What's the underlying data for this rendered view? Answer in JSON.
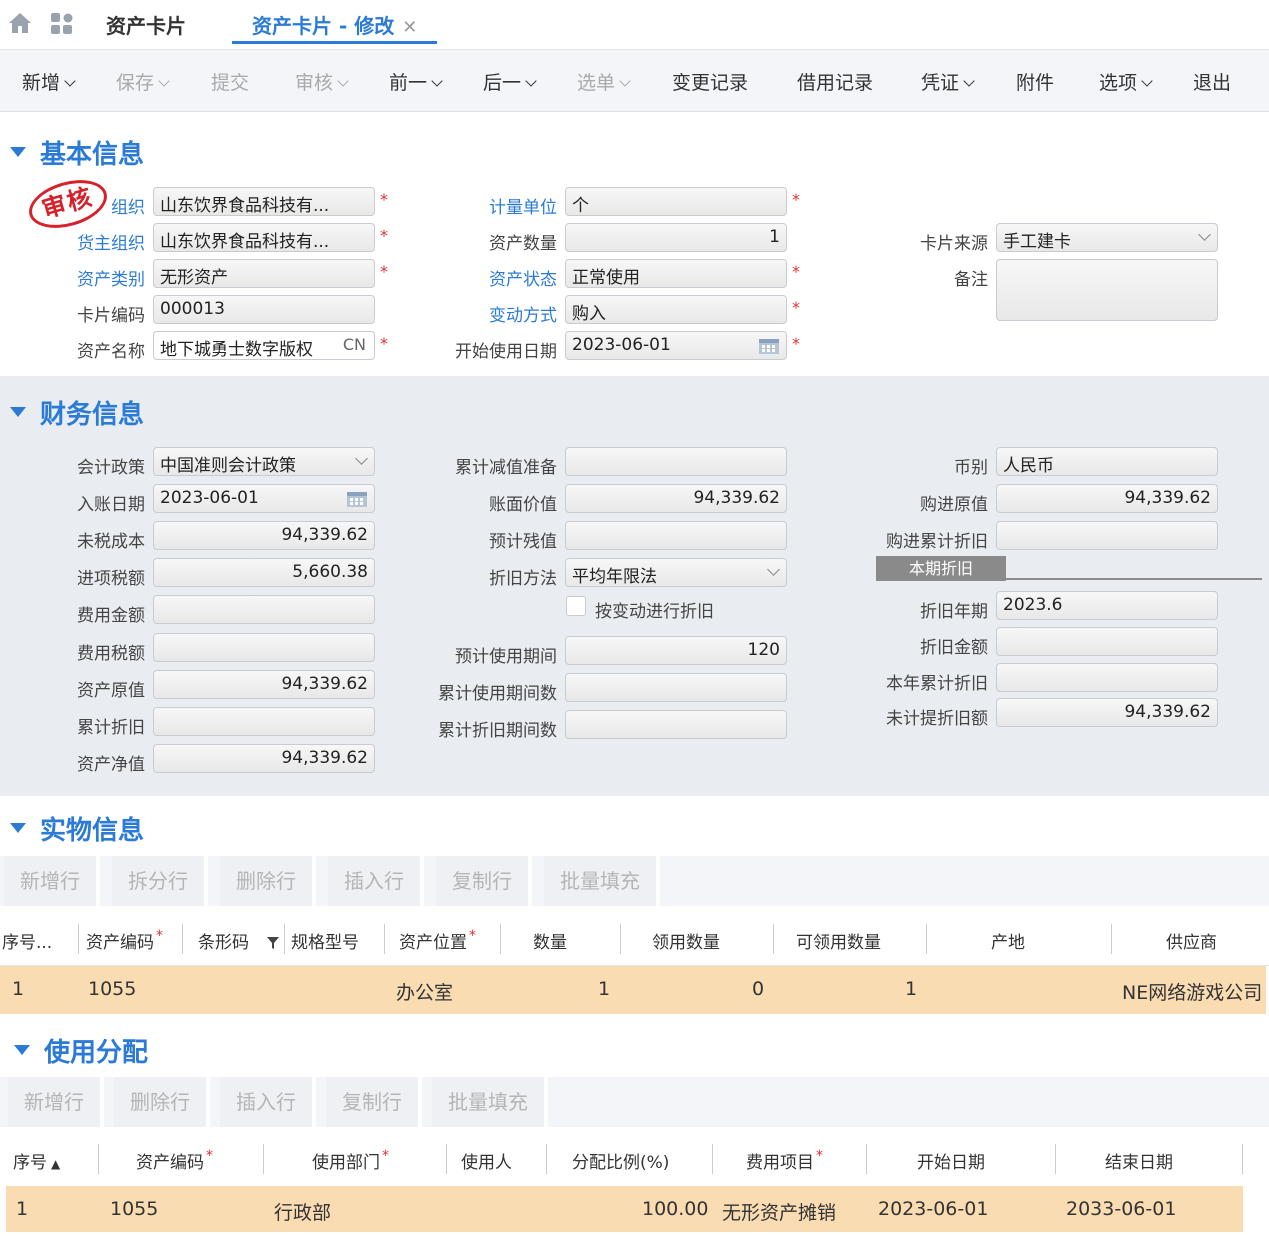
{
  "tabs": {
    "tab1": "资产卡片",
    "tab2": "资产卡片 - 修改"
  },
  "toolbar": {
    "add": "新增",
    "save": "保存",
    "submit": "提交",
    "audit": "审核",
    "prev": "前一",
    "next": "后一",
    "select": "选单",
    "change_log": "变更记录",
    "borrow_log": "借用记录",
    "voucher": "凭证",
    "attach": "附件",
    "options": "选项",
    "exit": "退出"
  },
  "stamp": "审核",
  "basic": {
    "title": "基本信息",
    "org_label": "组织",
    "org_value": "山东饮界食品科技有...",
    "owner_label": "货主组织",
    "owner_value": "山东饮界食品科技有...",
    "category_label": "资产类别",
    "category_value": "无形资产",
    "code_label": "卡片编码",
    "code_value": "000013",
    "name_label": "资产名称",
    "name_value": "地下城勇士数字版权",
    "name_lang": "CN",
    "unit_label": "计量单位",
    "unit_value": "个",
    "qty_label": "资产数量",
    "qty_value": "1",
    "status_label": "资产状态",
    "status_value": "正常使用",
    "change_label": "变动方式",
    "change_value": "购入",
    "start_label": "开始使用日期",
    "start_value": "2023-06-01",
    "source_label": "卡片来源",
    "source_value": "手工建卡",
    "note_label": "备注",
    "note_value": ""
  },
  "finance": {
    "title": "财务信息",
    "policy_label": "会计政策",
    "policy_value": "中国准则会计政策",
    "entry_label": "入账日期",
    "entry_value": "2023-06-01",
    "untaxed_label": "未税成本",
    "untaxed_value": "94,339.62",
    "input_tax_label": "进项税额",
    "input_tax_value": "5,660.38",
    "expense_label": "费用金额",
    "expense_value": "",
    "expense_tax_label": "费用税额",
    "expense_tax_value": "",
    "original_label": "资产原值",
    "original_value": "94,339.62",
    "accum_dep_label": "累计折旧",
    "accum_dep_value": "",
    "net_label": "资产净值",
    "net_value": "94,339.62",
    "impair_label": "累计减值准备",
    "impair_value": "",
    "book_label": "账面价值",
    "book_value": "94,339.62",
    "residual_label": "预计残值",
    "residual_value": "",
    "method_label": "折旧方法",
    "method_value": "平均年限法",
    "by_change_label": "按变动进行折旧",
    "life_label": "预计使用期间",
    "life_value": "120",
    "used_periods_label": "累计使用期间数",
    "used_periods_value": "",
    "dep_periods_label": "累计折旧期间数",
    "dep_periods_value": "",
    "currency_label": "币别",
    "currency_value": "人民币",
    "purchase_orig_label": "购进原值",
    "purchase_orig_value": "94,339.62",
    "purchase_dep_label": "购进累计折旧",
    "purchase_dep_value": "",
    "period_tab": "本期折旧",
    "dep_year_label": "折旧年期",
    "dep_year_value": "2023.6",
    "dep_amount_label": "折旧金额",
    "dep_amount_value": "",
    "year_dep_label": "本年累计折旧",
    "year_dep_value": "",
    "remain_label": "未计提折旧额",
    "remain_value": "94,339.62"
  },
  "physical": {
    "title": "实物信息",
    "buttons": [
      "新增行",
      "拆分行",
      "删除行",
      "插入行",
      "复制行",
      "批量填充"
    ],
    "headers": [
      "序号...",
      "资产编码",
      "条形码",
      "规格型号",
      "资产位置",
      "数量",
      "领用数量",
      "可领用数量",
      "产地",
      "供应商"
    ],
    "row": {
      "seq": "1",
      "code": "1055",
      "location": "办公室",
      "qty": "1",
      "used": "0",
      "available": "1",
      "supplier": "NE网络游戏公司"
    }
  },
  "allocation": {
    "title": "使用分配",
    "buttons": [
      "新增行",
      "删除行",
      "插入行",
      "复制行",
      "批量填充"
    ],
    "headers": [
      "序号",
      "资产编码",
      "使用部门",
      "使用人",
      "分配比例(%)",
      "费用项目",
      "开始日期",
      "结束日期"
    ],
    "row": {
      "seq": "1",
      "code": "1055",
      "dept": "行政部",
      "ratio": "100.00",
      "expense": "无形资产摊销",
      "start": "2023-06-01",
      "end": "2033-06-01"
    }
  }
}
